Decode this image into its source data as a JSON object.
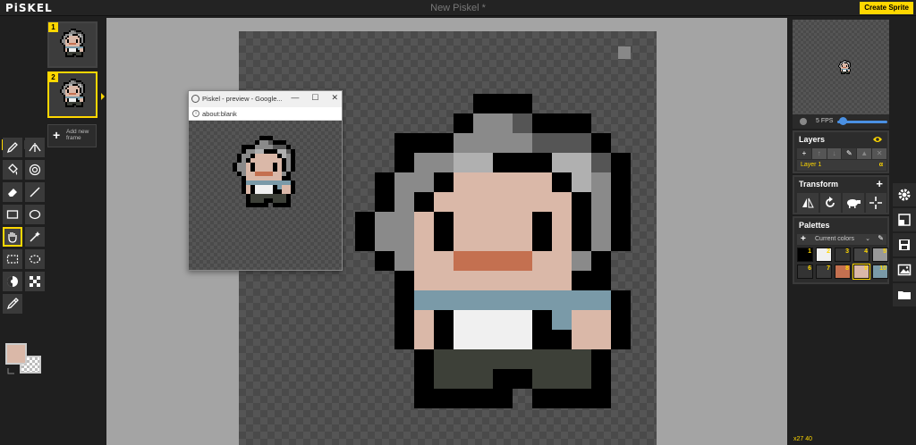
{
  "app": {
    "logo": "PiSKEL",
    "title": "New Piskel *",
    "create_button": "Create Sprite"
  },
  "frames": {
    "items": [
      {
        "number": "1",
        "active": false
      },
      {
        "number": "2",
        "active": true
      }
    ],
    "add_frame_label": "Add new frame"
  },
  "tools": [
    "pen-tool",
    "vertical-mirror-pen-tool",
    "paint-bucket-tool",
    "paint-all-same-color-tool",
    "eraser-tool",
    "stroke-tool",
    "rectangle-tool",
    "circle-tool",
    "move-tool",
    "shape-selection-tool",
    "rectangle-selection-tool",
    "lasso-selection-tool",
    "lighten-tool",
    "dithering-tool",
    "color-picker-tool"
  ],
  "colors": {
    "primary": "#dab8a8",
    "secondary": "transparent",
    "accent": "#ffd700"
  },
  "preview_window": {
    "title": "Piskel - preview - Google...",
    "url": "about:blank",
    "minimize": "—",
    "maximize": "☐",
    "close": "✕"
  },
  "animation": {
    "fps_label": "5 FPS"
  },
  "layers": {
    "title": "Layers",
    "items": [
      {
        "name": "Layer 1",
        "alpha": "α"
      }
    ]
  },
  "transform": {
    "title": "Transform"
  },
  "palettes": {
    "title": "Palettes",
    "current": "Current colors",
    "swatches": [
      {
        "n": "1",
        "color": "#000000"
      },
      {
        "n": "2",
        "color": "#f0f0f0"
      },
      {
        "n": "3",
        "color": "#333333"
      },
      {
        "n": "4",
        "color": "#444444"
      },
      {
        "n": "5",
        "color": "#999999"
      },
      {
        "n": "6",
        "color": "#333333"
      },
      {
        "n": "7",
        "color": "#3a3a3a"
      },
      {
        "n": "8",
        "color": "#c47050"
      },
      {
        "n": "9",
        "color": "#dab8a8"
      },
      {
        "n": "10",
        "color": "#7a9aa8"
      }
    ]
  },
  "status": {
    "coords": "x27 40"
  }
}
